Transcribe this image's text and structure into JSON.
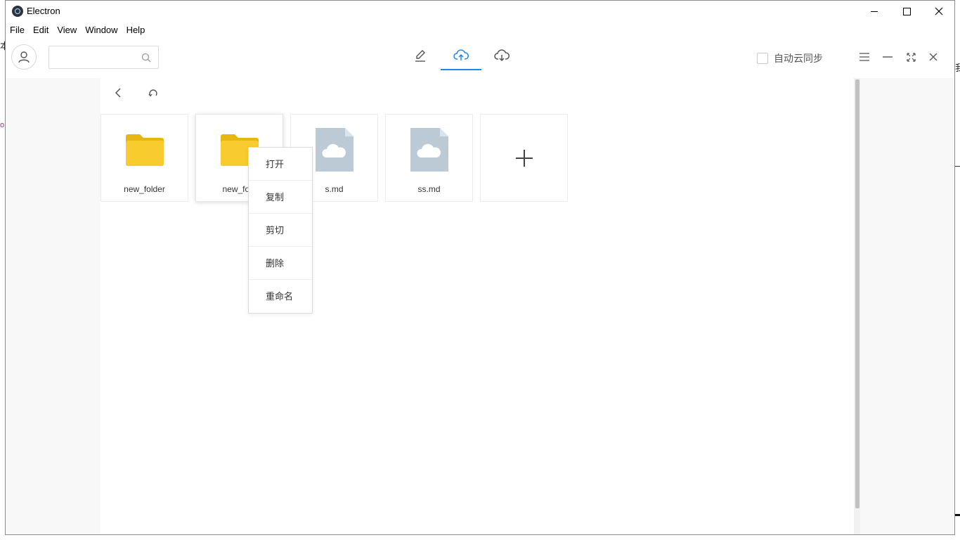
{
  "window": {
    "title": "Electron"
  },
  "menubar": [
    "File",
    "Edit",
    "View",
    "Window",
    "Help"
  ],
  "header": {
    "search": {
      "value": "",
      "placeholder": ""
    },
    "tabs": [
      {
        "icon": "edit-icon",
        "active": false
      },
      {
        "icon": "cloud-upload-icon",
        "active": true
      },
      {
        "icon": "cloud-download-icon",
        "active": false
      }
    ],
    "autosync": {
      "label": "自动云同步",
      "checked": false
    },
    "accent_color": "#1e88e5"
  },
  "files": [
    {
      "name": "new_folder",
      "type": "folder"
    },
    {
      "name": "new_folder",
      "type": "folder",
      "display": "new_fold"
    },
    {
      "name": "s.md",
      "type": "cloud-file"
    },
    {
      "name": "ss.md",
      "type": "cloud-file"
    }
  ],
  "context_menu": [
    "打开",
    "复制",
    "剪切",
    "删除",
    "重命名"
  ],
  "colors": {
    "folder": "#f8cb2e",
    "cloud_file": "#bccad6"
  }
}
